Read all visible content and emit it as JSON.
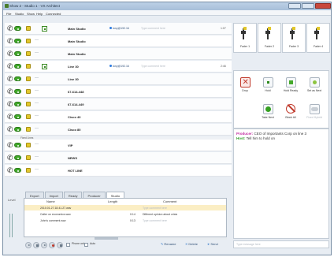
{
  "window": {
    "title": "Show 2 - Studio 1 - VX Architect"
  },
  "menu": [
    "File",
    "Studio",
    "Show",
    "Help",
    "Connected"
  ],
  "lines": [
    {
      "name": "Main Studio",
      "has_caller": true,
      "caller": "tony@192.16",
      "comment": "Type comment here",
      "duration": "1:07",
      "extra": "▣"
    },
    {
      "name": "Main Studio",
      "has_caller": false,
      "extra": "—"
    },
    {
      "name": "Main Studio",
      "has_caller": false,
      "extra": "—"
    },
    {
      "name": "Line 30",
      "has_caller": true,
      "caller": "tony@192.16",
      "comment": "Type comment here",
      "duration": "2:46",
      "extra": "▣"
    },
    {
      "name": "Line 30",
      "has_caller": false,
      "extra": "—"
    },
    {
      "name": "67-614-448",
      "has_caller": false,
      "extra": "—"
    },
    {
      "name": "67-614-449",
      "has_caller": false,
      "extra": "—"
    },
    {
      "name": "Cisco 40",
      "has_caller": false,
      "extra": "—"
    },
    {
      "name": "Cisco 80",
      "has_caller": false,
      "extra": "—"
    }
  ],
  "fixed_lines_label": "Fixed Lines",
  "fixed_lines": [
    {
      "name": "VIP"
    },
    {
      "name": "NEWS"
    },
    {
      "name": "HOT LINE"
    }
  ],
  "faders": [
    "Fader 1",
    "Fader 2",
    "Fader 3",
    "Fader 4"
  ],
  "controls": {
    "drop": "Drop",
    "hold": "Hold",
    "hold_ready": "Hold Ready",
    "set_as_next": "Set as Next",
    "take_next": "Take Next",
    "block_all": "Block All",
    "fixed_hybrid": "Fixed Hybrid"
  },
  "chat": {
    "producer_label": "Producer:",
    "producer_msg": "CEO of Importants Corp on line 3",
    "host_label": "Host:",
    "host_msg": "Tell him to hold on",
    "input_placeholder": "Type message here"
  },
  "tabs": [
    "Export",
    "Import",
    "Ready",
    "Producer",
    "Studio"
  ],
  "active_tab": "Studio",
  "file_table": {
    "headers": {
      "name": "Name",
      "length": "Length",
      "comment": "Comment"
    },
    "rows": [
      {
        "name": "2010.01.27.18.41.27.wav",
        "length": "",
        "comment": "Type comment here",
        "selected": true
      },
      {
        "name": "Caller on economics.wav",
        "length": "0:14",
        "comment": "Different opinion about crisis",
        "selected": false
      },
      {
        "name": "John's comment.wav",
        "length": "0:13",
        "comment": "Type comment here",
        "selected": false
      }
    ]
  },
  "left_gutter_label": "Level",
  "bottom": {
    "phone_only": "Phone only",
    "auto": "Auto",
    "rename": "Rename",
    "delete": "Delete",
    "send": "Send"
  }
}
